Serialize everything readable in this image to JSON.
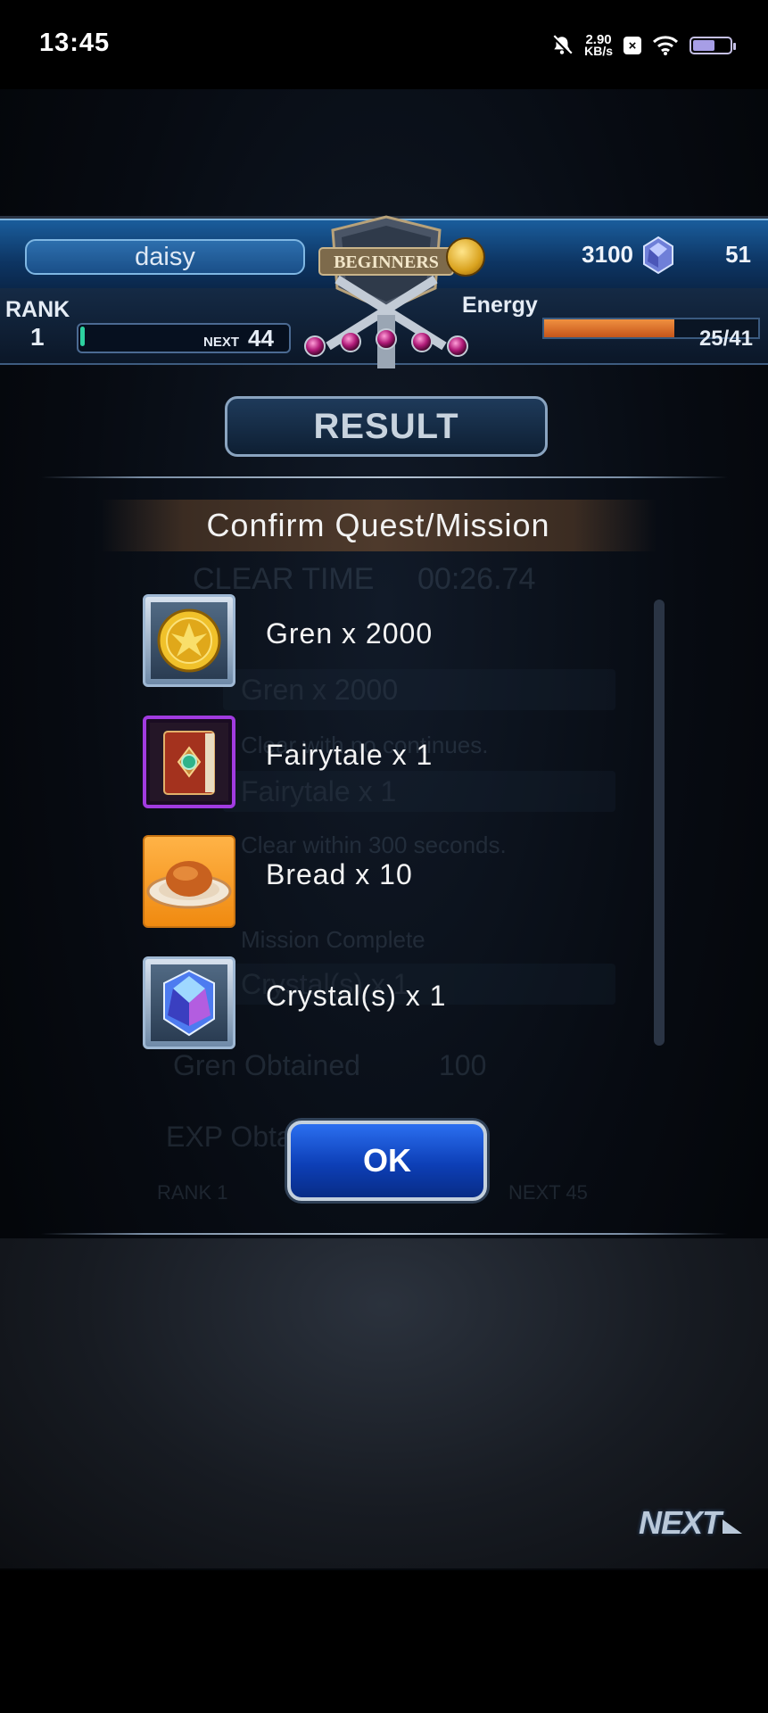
{
  "status_bar": {
    "time": "13:45",
    "net_speed": "2.90",
    "net_unit": "KB/s",
    "battery_level_fraction": 0.6
  },
  "hud": {
    "player_name": "daisy",
    "badge_text": "BEGINNERS",
    "gren": "3100",
    "crystals": "51",
    "rank_label": "RANK",
    "rank_value": "1",
    "next_label": "NEXT",
    "next_value": "44",
    "exp_fraction": 0.02,
    "energy_label": "Energy",
    "energy_value": "25/41",
    "energy_fraction": 0.61
  },
  "result": {
    "plate_label": "RESULT"
  },
  "dialog": {
    "title": "Confirm Quest/Mission",
    "rewards": [
      {
        "label": "Gren x 2000",
        "icon": "gold-coin-icon"
      },
      {
        "label": "Fairytale x 1",
        "icon": "book-icon"
      },
      {
        "label": "Bread x 10",
        "icon": "bread-icon"
      },
      {
        "label": "Crystal(s) x 1",
        "icon": "crystal-icon"
      }
    ],
    "ok_label": "OK"
  },
  "background_results": {
    "clear_time_label": "CLEAR TIME",
    "clear_time_value": "00:26.74",
    "mission_1": "Clear with no continues.",
    "mission_2": "Clear within 300 seconds.",
    "mission_3": "Mission Complete",
    "reward_1": "Gren x 2000",
    "reward_2": "Fairytale x 1",
    "reward_3": "Crystal(s) x 1",
    "gren_obtained_label": "Gren Obtained",
    "gren_obtained_value": "100",
    "exp_label": "EXP Obtained",
    "rank_line": "RANK 1",
    "next_line": "NEXT 45"
  },
  "navigation": {
    "next_label": "NEXT"
  },
  "colors": {
    "hud_blue": "#1a5d9c",
    "ok_blue": "#0d3fb7",
    "energy_orange": "#e07428",
    "rare_purple": "#a13be0"
  }
}
